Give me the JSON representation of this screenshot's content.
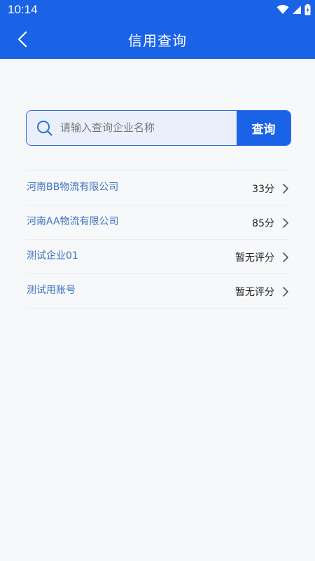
{
  "status_bar": {
    "time": "10:14",
    "icons": [
      "wifi-icon",
      "signal-icon",
      "battery-icon"
    ]
  },
  "header": {
    "title": "信用查询",
    "back_icon": "chevron-left-icon"
  },
  "search": {
    "placeholder": "请输入查询企业名称",
    "value": "",
    "button_label": "查询",
    "icon": "search-icon"
  },
  "companies": [
    {
      "name": "河南BB物流有限公司",
      "score": "33分"
    },
    {
      "name": "河南AA物流有限公司",
      "score": "85分"
    },
    {
      "name": "测试企业01",
      "score": "暂无评分"
    },
    {
      "name": "测试用账号",
      "score": "暂无评分"
    }
  ],
  "colors": {
    "primary": "#1a63e6",
    "link_text": "#3b72c2",
    "background": "#f7f8fa"
  }
}
